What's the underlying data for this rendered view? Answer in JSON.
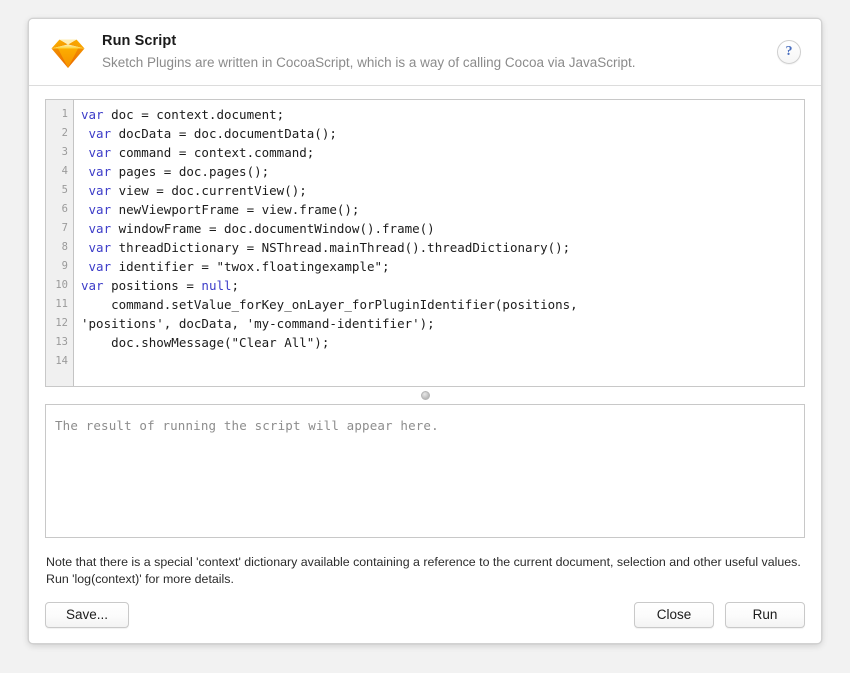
{
  "window": {
    "title": "Run Script",
    "subtitle": "Sketch Plugins are written in CocoaScript, which is a way of calling Cocoa via JavaScript.",
    "app_icon": "sketch-diamond-icon",
    "help_glyph": "?"
  },
  "editor": {
    "gutter_numbers": [
      "1",
      "2",
      "3",
      "4",
      "5",
      "6",
      "7",
      "8",
      "9",
      "10",
      "11",
      "12",
      "13",
      "14"
    ],
    "lines": [
      {
        "n": "1",
        "indent": 0,
        "keyword": "var",
        "rest": " doc = context.document;"
      },
      {
        "n": "2",
        "indent": 1,
        "keyword": "var",
        "rest": " docData = doc.documentData();"
      },
      {
        "n": "3",
        "indent": 1,
        "keyword": "var",
        "rest": " command = context.command;"
      },
      {
        "n": "4",
        "indent": 1,
        "keyword": "var",
        "rest": " pages = doc.pages();"
      },
      {
        "n": "5",
        "indent": 1,
        "keyword": "var",
        "rest": " view = doc.currentView();"
      },
      {
        "n": "6",
        "indent": 1,
        "keyword": "var",
        "rest": " newViewportFrame = view.frame();"
      },
      {
        "n": "7",
        "indent": 1,
        "keyword": "var",
        "rest": " windowFrame = doc.documentWindow().frame()"
      },
      {
        "n": "8",
        "indent": 1,
        "keyword": "var",
        "rest": " threadDictionary = NSThread.mainThread().threadDictionary();"
      },
      {
        "n": "9",
        "indent": 1,
        "keyword": "var",
        "rest": " identifier = \"twox.floatingexample\";"
      },
      {
        "n": "10",
        "indent": 0,
        "keyword": "var",
        "rest": " positions = null;",
        "keyword2": "null"
      },
      {
        "n": "11",
        "indent": 2,
        "keyword": "",
        "rest": "command.setValue_forKey_onLayer_forPluginIdentifier(positions,",
        "wrap": "'positions', docData, 'my-command-identifier');"
      },
      {
        "n": "12",
        "indent": 2,
        "keyword": "",
        "rest": "doc.showMessage(\"Clear All\");"
      },
      {
        "n": "13",
        "indent": 0,
        "keyword": "",
        "rest": ""
      },
      {
        "n": "14",
        "indent": 0,
        "keyword": "",
        "rest": ""
      }
    ],
    "line_10_full": "var positions = null;",
    "line_10_kw1": "var",
    "line_10_mid": " positions = ",
    "line_10_kw2": "null",
    "line_10_end": ";"
  },
  "result": {
    "placeholder": "The result of running the script will appear here."
  },
  "note": {
    "text": "Note that there is a special 'context' dictionary available containing a reference to the current document, selection and other useful values. Run 'log(context)' for more details."
  },
  "footer": {
    "save_label": "Save...",
    "close_label": "Close",
    "run_label": "Run"
  },
  "colors": {
    "keyword": "#3c3cc8",
    "code_text": "#1c1c1c",
    "placeholder": "#8d8d8d",
    "subtitle": "#8b8b8b",
    "help_blue": "#4a6fbf",
    "gutter_bg": "#f0f0f0",
    "page_bg": "#f2f2f2"
  }
}
